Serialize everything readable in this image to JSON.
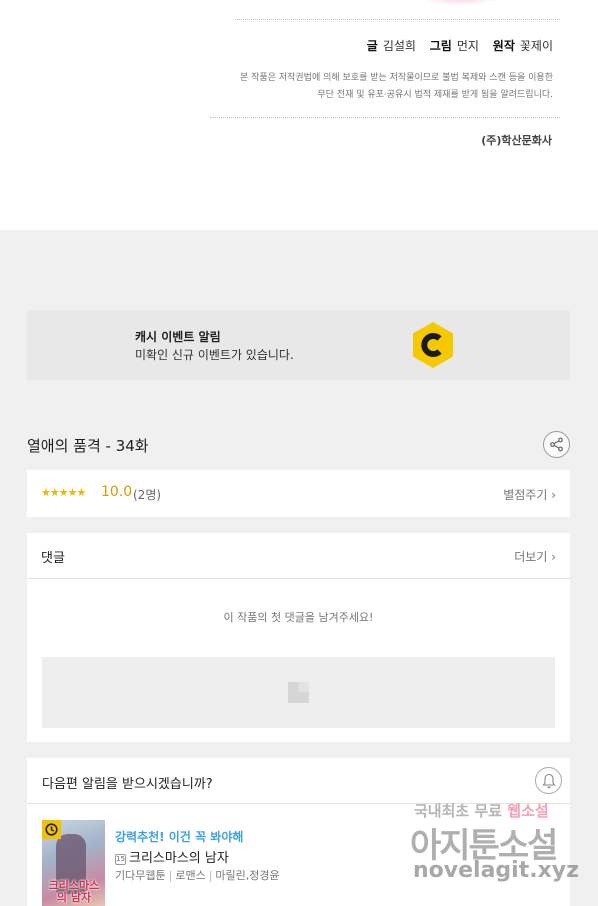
{
  "credits": {
    "writer_label": "글",
    "writer": "김설희",
    "artist_label": "그림",
    "artist": "먼지",
    "original_label": "원작",
    "original": "꽃제이"
  },
  "notice": {
    "line1": "본 작품은 저작권법에 의해 보호를 받는 저작물이므로 불법 복제와 스캔 등을 이용한",
    "line2": "무단 전재 및 유포·공유시 법적 제재를 받게 됨을 알려드립니다."
  },
  "publisher": "(주)학산문화사",
  "event_banner": {
    "title": "캐시 이벤트 알림",
    "subtitle": "미확인 신규 이벤트가 있습니다.",
    "icon": "cash-coin-icon",
    "icon_color": "#f5c800"
  },
  "episode": {
    "title": "열애의 품격 - 34화"
  },
  "rating": {
    "stars": "★★★★★",
    "score": "10.0",
    "count": "(2명)",
    "rate_link": "별점주기 ›"
  },
  "comments": {
    "label": "댓글",
    "more_link": "더보기 ›",
    "empty_message": "이 작품의 첫 댓글을 남겨주세요!"
  },
  "notify": {
    "question": "다음편 알림을 받으시겠습니까?"
  },
  "recommendation": {
    "promo": "강력추천! 이건 꼭 봐야해",
    "age_badge": "15",
    "title": "크리스마스의 남자",
    "meta": [
      "기다무웹툰",
      "로맨스",
      "마릴린,정경윤"
    ],
    "thumb_text": "크리스마스의 남자"
  },
  "watermark": {
    "line1_a": "국내최초 무료",
    "line1_b": "웹소설",
    "line2": "아지툰소설",
    "line3": "novelagit.xyz"
  }
}
